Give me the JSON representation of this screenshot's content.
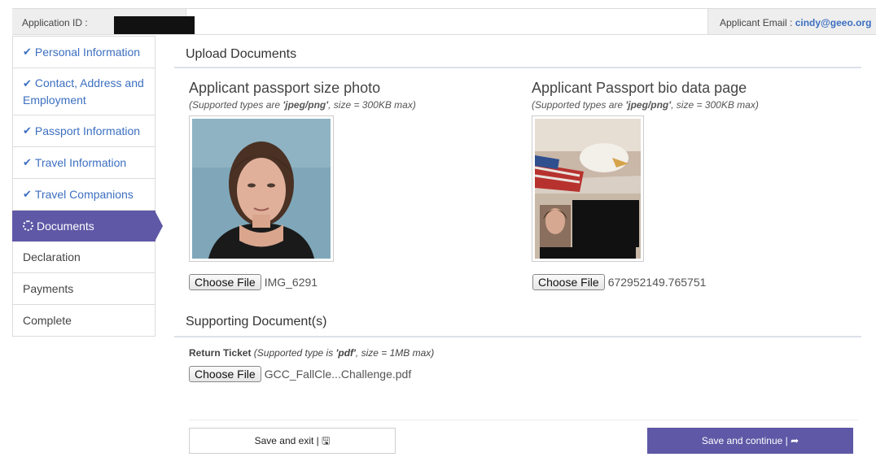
{
  "header": {
    "app_id_label": "Application ID :",
    "email_label": "Applicant Email : ",
    "email_value": "cindy@geeo.org"
  },
  "sidebar": {
    "items": [
      {
        "label": "Personal Information"
      },
      {
        "label": "Contact, Address and Employment"
      },
      {
        "label": "Passport Information"
      },
      {
        "label": "Travel Information"
      },
      {
        "label": "Travel Companions"
      },
      {
        "label": "Documents"
      },
      {
        "label": "Declaration"
      },
      {
        "label": "Payments"
      },
      {
        "label": "Complete"
      }
    ]
  },
  "upload": {
    "section_title": "Upload Documents",
    "photo": {
      "title": "Applicant passport size photo",
      "hint_prefix": "(Supported types are ",
      "hint_types": "'jpeg/png'",
      "hint_suffix": ", size = 300KB max)",
      "button": "Choose File",
      "filename": "IMG_6291"
    },
    "bio": {
      "title": "Applicant Passport bio data page",
      "hint_prefix": "(Supported types are ",
      "hint_types": "'jpeg/png'",
      "hint_suffix": ", size = 300KB max)",
      "button": "Choose File",
      "filename": "672952149.765751"
    }
  },
  "supporting": {
    "section_title": "Supporting Document(s)",
    "ticket_label": "Return Ticket",
    "ticket_hint_prefix": " (Supported type is ",
    "ticket_hint_type": "'pdf'",
    "ticket_hint_suffix": ", size = 1MB max)",
    "button": "Choose File",
    "filename": "GCC_FallCle...Challenge.pdf"
  },
  "actions": {
    "save_exit": "Save and exit | 🖫",
    "save_continue": "Save and continue | ➦"
  },
  "colors": {
    "accent": "#5e58a6",
    "link": "#3c6fc0"
  }
}
